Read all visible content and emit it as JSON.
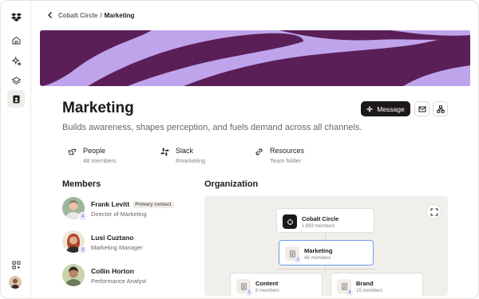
{
  "breadcrumb": {
    "parent": "Cobalt Circle",
    "separator": "/",
    "current": "Marketing"
  },
  "team": {
    "name": "Marketing",
    "description": "Builds awareness, shapes perception, and fuels demand across all channels."
  },
  "actions": {
    "message_label": "Message"
  },
  "info": [
    {
      "label": "People",
      "sub": "48 members",
      "icon": "people-icon"
    },
    {
      "label": "Slack",
      "sub": "#marketing",
      "icon": "slack-icon"
    },
    {
      "label": "Resources",
      "sub": "Team folder",
      "icon": "link-icon"
    }
  ],
  "sections": {
    "members": "Members",
    "organization": "Organization"
  },
  "members": [
    {
      "name": "Frank Levitt",
      "tag": "Primary contact",
      "role": "Director of Marketing",
      "badge": "4"
    },
    {
      "name": "Lusi Cuztano",
      "tag": "",
      "role": "Marketing Manager",
      "badge": "3"
    },
    {
      "name": "Collin Horton",
      "tag": "",
      "role": "Performance Analyst",
      "badge": ""
    }
  ],
  "org": {
    "root": {
      "name": "Cobalt Circle",
      "sub": "1,863 members"
    },
    "current": {
      "name": "Marketing",
      "sub": "48 members",
      "badge": "3"
    },
    "children": [
      {
        "name": "Content",
        "sub": "6 members",
        "badge": "3"
      },
      {
        "name": "Brand",
        "sub": "15 members",
        "badge": "4"
      }
    ]
  },
  "colors": {
    "banner_bg": "#bfa4ec",
    "banner_ink": "#5b1f57",
    "primary_button": "#1e1919",
    "selected_node_border": "#6f9be8"
  }
}
